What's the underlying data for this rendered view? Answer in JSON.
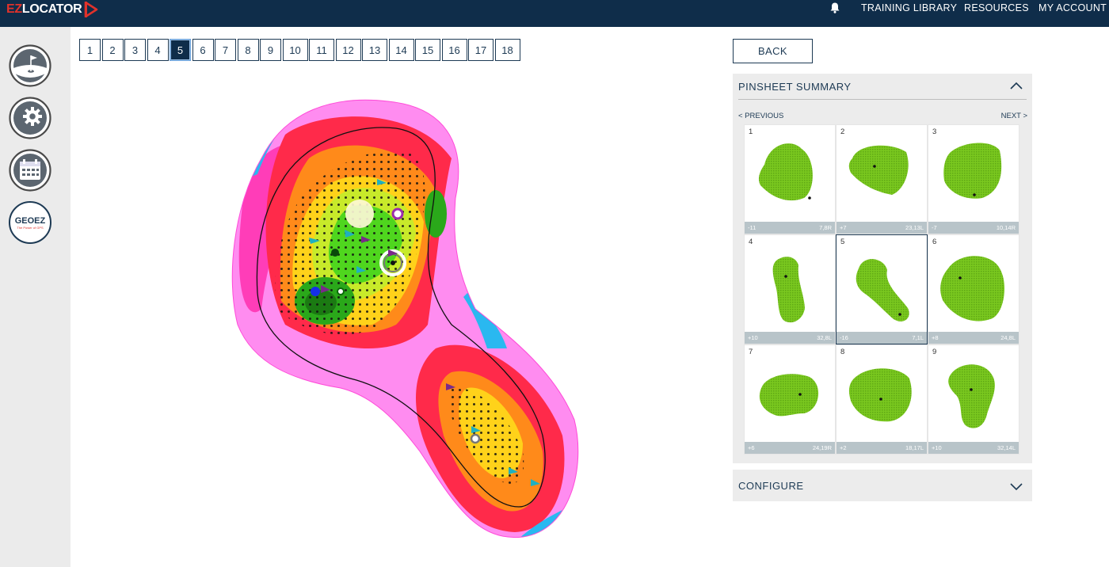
{
  "brand": {
    "name_red": "EZ",
    "name_white": "LOCATOR"
  },
  "nav": {
    "training_library": "TRAINING LIBRARY",
    "resources": "RESOURCES",
    "my_account": "MY ACCOUNT"
  },
  "holes": [
    "1",
    "2",
    "3",
    "4",
    "5",
    "6",
    "7",
    "8",
    "9",
    "10",
    "11",
    "12",
    "13",
    "14",
    "15",
    "16",
    "17",
    "18"
  ],
  "active_hole": "5",
  "back_label": "BACK",
  "sidebar_logo_text": "GEOEZ",
  "sidebar_logo_tagline": "The Power of GPS",
  "pinsheet": {
    "title": "PINSHEET SUMMARY",
    "prev_label": "< PREVIOUS",
    "next_label": "NEXT >",
    "cards": [
      {
        "num": "1",
        "left": "-11",
        "right": "7,8R"
      },
      {
        "num": "2",
        "left": "+7",
        "right": "23,13L"
      },
      {
        "num": "3",
        "left": "-7",
        "right": "10,14R"
      },
      {
        "num": "4",
        "left": "+10",
        "right": "32,8L"
      },
      {
        "num": "5",
        "left": "-16",
        "right": "7,1L"
      },
      {
        "num": "6",
        "left": "+8",
        "right": "24,8L"
      },
      {
        "num": "7",
        "left": "+6",
        "right": "24,19R"
      },
      {
        "num": "8",
        "left": "+2",
        "right": "18,17L"
      },
      {
        "num": "9",
        "left": "+10",
        "right": "32,14L"
      }
    ]
  },
  "configure": {
    "title": "CONFIGURE"
  },
  "colors": {
    "navy": "#0f2d4a",
    "accent_red": "#e0322b",
    "green": "#7ac81f"
  }
}
